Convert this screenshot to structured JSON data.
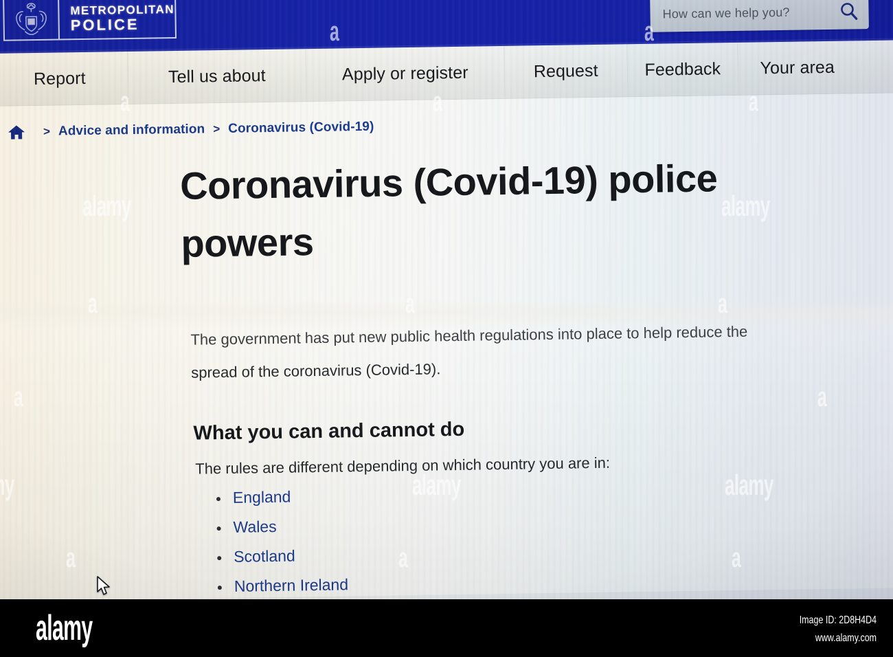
{
  "header": {
    "logo": {
      "crest_icon": "coat-of-arms-crest-icon",
      "line1": "METROPOLITAN",
      "line2": "POLICE"
    },
    "search": {
      "placeholder": "How can we help you?",
      "value": "",
      "icon": "search-icon"
    },
    "brand_color": "#1620a6"
  },
  "nav": {
    "items": [
      {
        "label": "Report"
      },
      {
        "label": "Tell us about"
      },
      {
        "label": "Apply or register"
      },
      {
        "label": "Request"
      },
      {
        "label": "Feedback"
      },
      {
        "label": "Your area"
      }
    ]
  },
  "breadcrumb": {
    "home_icon": "home-icon",
    "separator": ">",
    "items": [
      {
        "label": "Advice and information"
      },
      {
        "label": "Coronavirus (Covid-19)"
      }
    ],
    "link_color": "#1b3a8f"
  },
  "main": {
    "title": "Coronavirus (Covid-19) police powers",
    "lede": "The government has put new public health regulations into place to help reduce the spread of the coronavirus (Covid-19).",
    "section_heading": "What you can and cannot do",
    "section_intro": "The rules are different depending on which country you are in:",
    "country_links": [
      {
        "label": "England"
      },
      {
        "label": "Wales"
      },
      {
        "label": "Scotland"
      },
      {
        "label": "Northern Ireland"
      }
    ]
  },
  "watermark": {
    "word": "alamy",
    "letter": "a"
  },
  "footer": {
    "brand": "alamy",
    "image_id": "Image ID: 2D8H4D4",
    "website": "www.alamy.com",
    "background": "#000000"
  },
  "cursor": {
    "icon": "mouse-pointer-icon"
  }
}
